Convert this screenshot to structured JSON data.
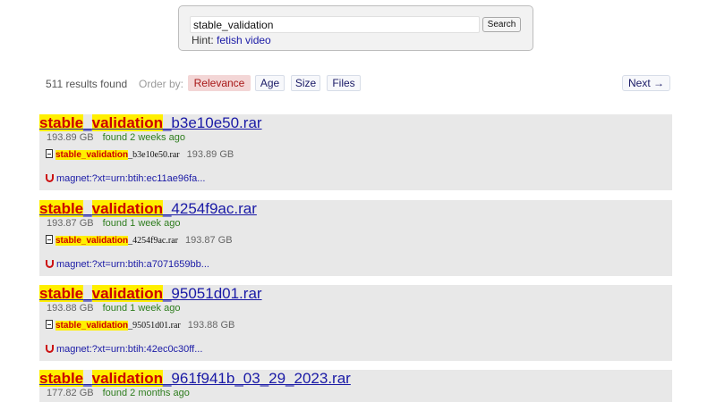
{
  "search": {
    "query": "stable_validation",
    "button_label": "Search",
    "hint_label": "Hint:",
    "hint_link": "fetish video"
  },
  "results_bar": {
    "count": "511 results found",
    "order_label": "Order by:",
    "sort_options": [
      "Relevance",
      "Age",
      "Size",
      "Files"
    ],
    "active_sort": "Relevance",
    "next_label": "Next →"
  },
  "highlight": {
    "term_a": "stable",
    "sep": "_",
    "term_b": "validation"
  },
  "results": [
    {
      "title_suffix": "_b3e10e50.rar",
      "size": "193.89 GB",
      "age": "found 2 weeks ago",
      "file_suffix": "_b3e10e50.rar",
      "file_size": "193.89 GB",
      "magnet": "magnet:?xt=urn:btih:ec11ae96fa..."
    },
    {
      "title_suffix": "_4254f9ac.rar",
      "size": "193.87 GB",
      "age": "found 1 week ago",
      "file_suffix": "_4254f9ac.rar",
      "file_size": "193.87 GB",
      "magnet": "magnet:?xt=urn:btih:a7071659bb..."
    },
    {
      "title_suffix": "_95051d01.rar",
      "size": "193.88 GB",
      "age": "found 1 week ago",
      "file_suffix": "_95051d01.rar",
      "file_size": "193.88 GB",
      "magnet": "magnet:?xt=urn:btih:42ec0c30ff..."
    },
    {
      "title_suffix": "_961f941b_03_29_2023.rar",
      "size": "177.82 GB",
      "age": "found 2 months ago"
    }
  ],
  "colors": {
    "link": "#1a1aa6",
    "highlight_bg": "#ffef00",
    "highlight_text": "#cc0000",
    "age_text": "#2e7d1e",
    "card_bg": "#e8e8e8",
    "active_sort_bg": "#f3d6d6"
  },
  "icons": {
    "file": "file-icon",
    "magnet": "magnet-icon"
  }
}
